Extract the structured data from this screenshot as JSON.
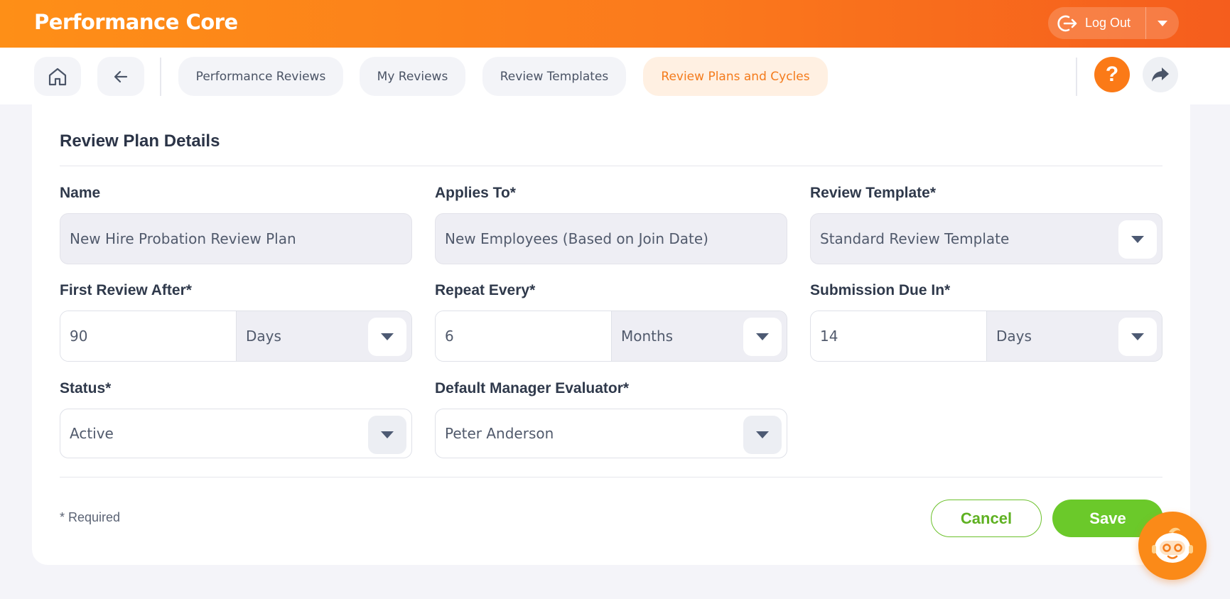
{
  "app": {
    "title": "Performance Core"
  },
  "header": {
    "logout_label": "Log Out"
  },
  "nav": {
    "tabs": [
      {
        "label": "Performance Reviews"
      },
      {
        "label": "My Reviews"
      },
      {
        "label": "Review Templates"
      },
      {
        "label": "Review Plans and Cycles",
        "active": true
      }
    ],
    "help_glyph": "?"
  },
  "form": {
    "title": "Review Plan Details",
    "name": {
      "label": "Name",
      "value": "New Hire Probation Review Plan"
    },
    "applies_to": {
      "label": "Applies To*",
      "value": "New Employees (Based on Join Date)"
    },
    "review_template": {
      "label": "Review Template*",
      "value": "Standard Review Template"
    },
    "first_review_after": {
      "label": "First Review After*",
      "value": "90",
      "unit": "Days"
    },
    "repeat_every": {
      "label": "Repeat Every*",
      "value": "6",
      "unit": "Months"
    },
    "submission_due_in": {
      "label": "Submission Due In*",
      "value": "14",
      "unit": "Days"
    },
    "status": {
      "label": "Status*",
      "value": "Active"
    },
    "default_manager": {
      "label": "Default Manager Evaluator*",
      "value": "Peter Anderson"
    },
    "required_note": "* Required",
    "cancel_label": "Cancel",
    "save_label": "Save"
  },
  "icons": {
    "logout": "logout-icon",
    "home": "home-icon",
    "back": "arrow-left-icon",
    "help": "question-icon",
    "share": "share-arrow-icon",
    "assistant": "robot-assistant-icon",
    "dropdown": "caret-down-icon"
  },
  "colors": {
    "brand_orange": "#fb7a17",
    "active_tab_bg": "#fff0e2",
    "save_green": "#6bc92a",
    "page_bg": "#f4f4f9"
  }
}
